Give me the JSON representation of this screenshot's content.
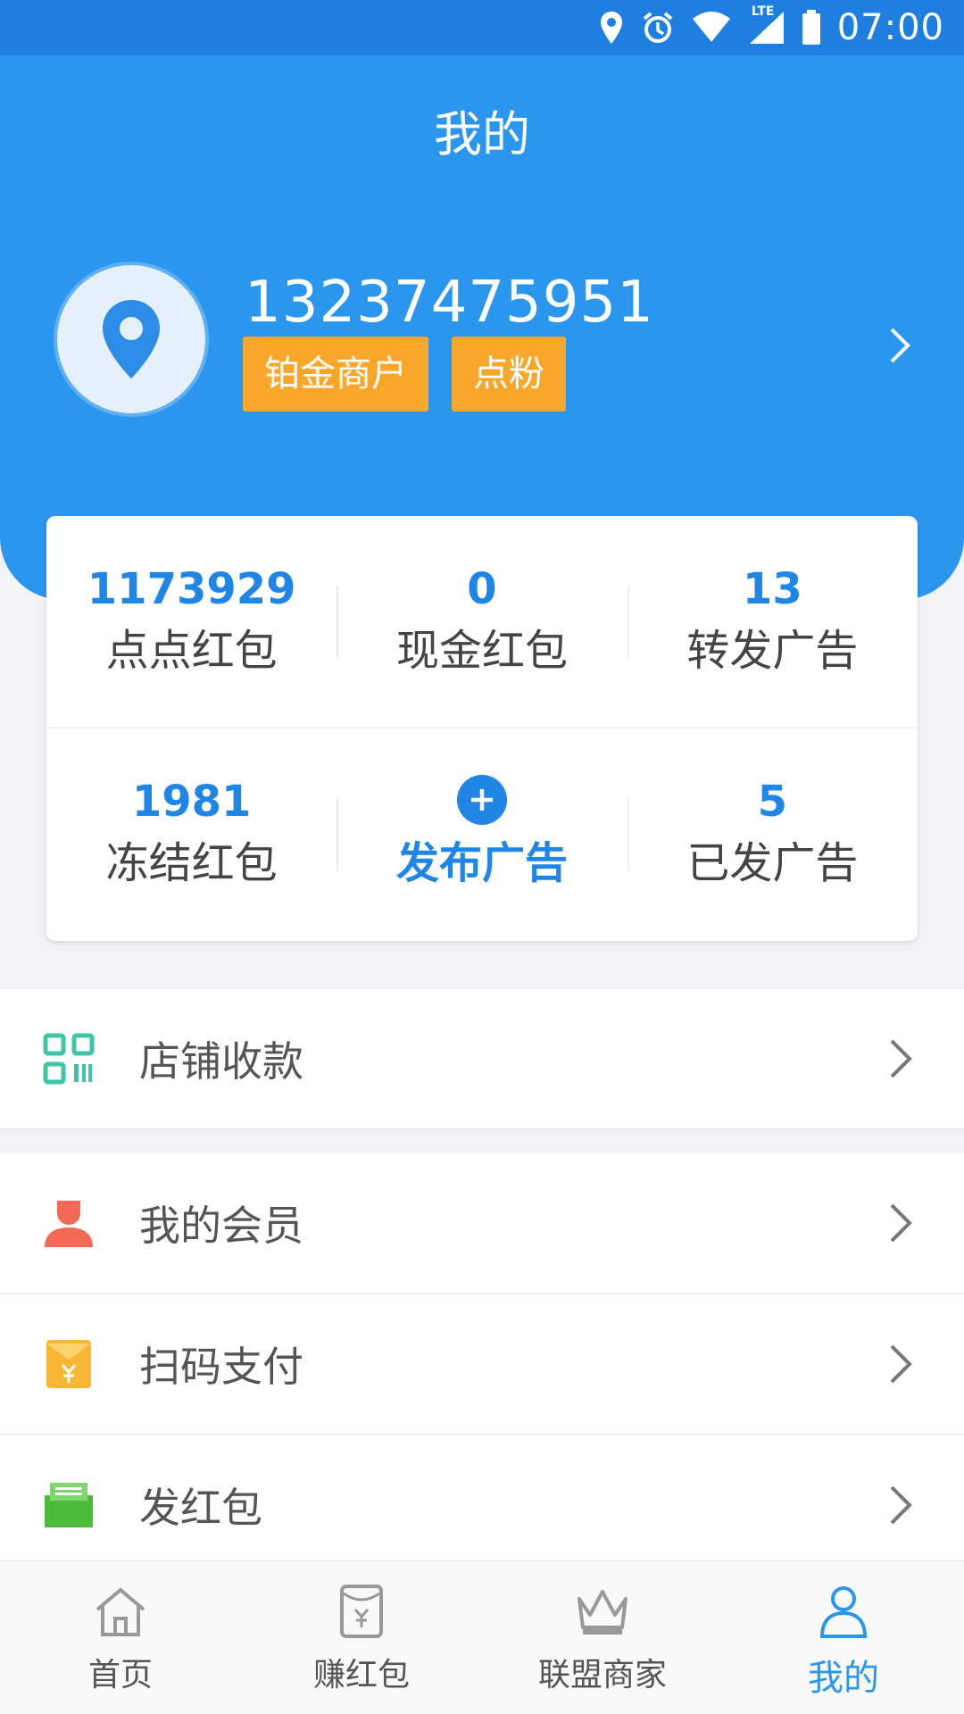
{
  "status_bar": {
    "time": "07:00",
    "lte_label": "LTE",
    "icons": [
      "location-icon",
      "alarm-icon",
      "wifi-icon",
      "signal-icon",
      "battery-icon"
    ]
  },
  "header": {
    "title": "我的",
    "phone": "13237475951",
    "badges": [
      "铂金商户",
      "点粉"
    ]
  },
  "stats": {
    "row1": [
      {
        "value": "1173929",
        "label": "点点红包"
      },
      {
        "value": "0",
        "label": "现金红包"
      },
      {
        "value": "13",
        "label": "转发广告"
      }
    ],
    "row2": [
      {
        "value": "1981",
        "label": "冻结红包"
      },
      {
        "label": "发布广告"
      },
      {
        "value": "5",
        "label": "已发广告"
      }
    ]
  },
  "menu": [
    {
      "label": "店铺收款",
      "icon": "qr-code-icon"
    },
    {
      "label": "我的会员",
      "icon": "member-icon"
    },
    {
      "label": "扫码支付",
      "icon": "envelope-yen-icon"
    },
    {
      "label": "发红包",
      "icon": "gift-box-icon"
    }
  ],
  "tabs": [
    {
      "label": "首页",
      "icon": "home-icon"
    },
    {
      "label": "赚红包",
      "icon": "wallet-yen-icon"
    },
    {
      "label": "联盟商家",
      "icon": "crown-icon"
    },
    {
      "label": "我的",
      "icon": "user-icon",
      "active": true
    }
  ],
  "colors": {
    "primary": "#2b96ee",
    "status_bar": "#1f7fe0",
    "badge": "#f8a72b",
    "accent_text": "#1f86e6"
  }
}
